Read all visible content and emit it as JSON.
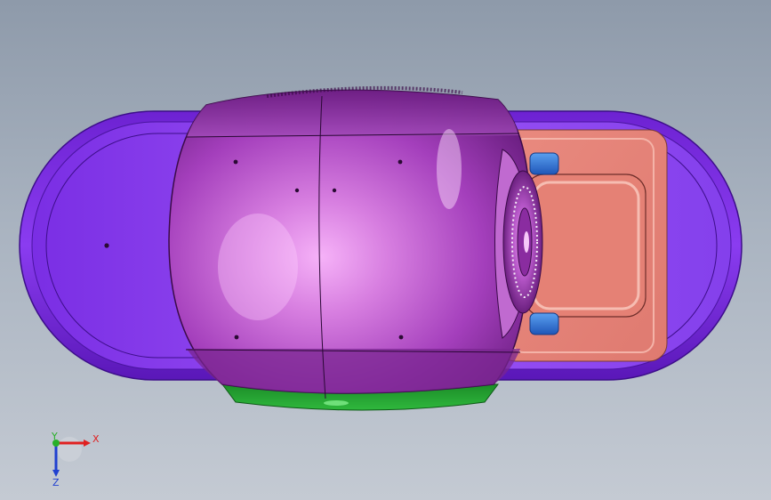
{
  "colors": {
    "background_top": "#8e9aaa",
    "background_bottom": "#c4cad3",
    "base_purple": "#7f2fe0",
    "base_purple_dark": "#4e13a8",
    "body_magenta": "#b34fc8",
    "body_highlight": "#f3a6f7",
    "body_dark": "#5d176f",
    "tray_salmon": "#e8847a",
    "tray_edge": "#f1a79c",
    "clip_blue": "#2d6fd6",
    "bottom_green": "#1f9a2d",
    "axis_x": "#e02020",
    "axis_y": "#28b028",
    "axis_z": "#2040d0"
  },
  "triad": {
    "x_label": "X",
    "y_label": "Y",
    "z_label": "Z"
  }
}
